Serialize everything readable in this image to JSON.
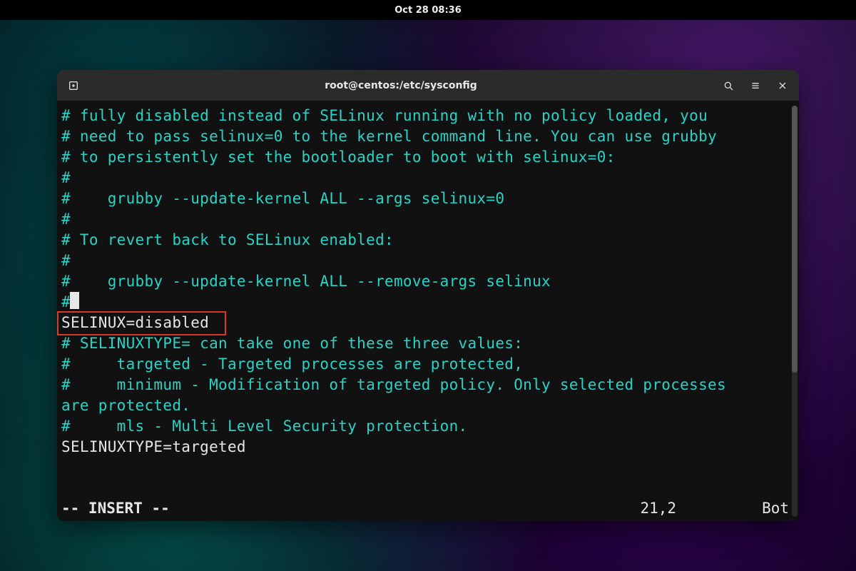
{
  "panel": {
    "clock": "Oct 28  08:36"
  },
  "window": {
    "title": "root@centos:/etc/sysconfig",
    "lines": [
      {
        "cls": "c-comment",
        "text": "# fully disabled instead of SELinux running with no policy loaded, you"
      },
      {
        "cls": "c-comment",
        "text": "# need to pass selinux=0 to the kernel command line. You can use grubby"
      },
      {
        "cls": "c-comment",
        "text": "# to persistently set the bootloader to boot with selinux=0:"
      },
      {
        "cls": "c-comment",
        "text": "#"
      },
      {
        "cls": "c-comment",
        "text": "#    grubby --update-kernel ALL --args selinux=0"
      },
      {
        "cls": "c-comment",
        "text": "#"
      },
      {
        "cls": "c-comment",
        "text": "# To revert back to SELinux enabled:"
      },
      {
        "cls": "c-comment",
        "text": "#"
      },
      {
        "cls": "c-comment",
        "text": "#    grubby --update-kernel ALL --remove-args selinux"
      },
      {
        "cls": "c-comment",
        "text": "#",
        "cursor_after": true
      },
      {
        "cls": "c-plain",
        "text": "SELINUX=disabled",
        "highlighted": true
      },
      {
        "cls": "c-comment",
        "text": "# SELINUXTYPE= can take one of these three values:"
      },
      {
        "cls": "c-comment",
        "text": "#     targeted - Targeted processes are protected,"
      },
      {
        "cls": "c-comment",
        "text": "#     minimum - Modification of targeted policy. Only selected processes"
      },
      {
        "cls": "c-comment",
        "text": "are protected."
      },
      {
        "cls": "c-comment",
        "text": "#     mls - Multi Level Security protection."
      },
      {
        "cls": "c-plain",
        "text": "SELINUXTYPE=targeted"
      }
    ],
    "status": {
      "mode": "-- INSERT --",
      "position": "21,2",
      "scroll": "Bot"
    }
  },
  "icons": {
    "new_tab": "new-tab-icon",
    "search": "search-icon",
    "menu": "hamburger-menu-icon",
    "close": "close-icon"
  }
}
